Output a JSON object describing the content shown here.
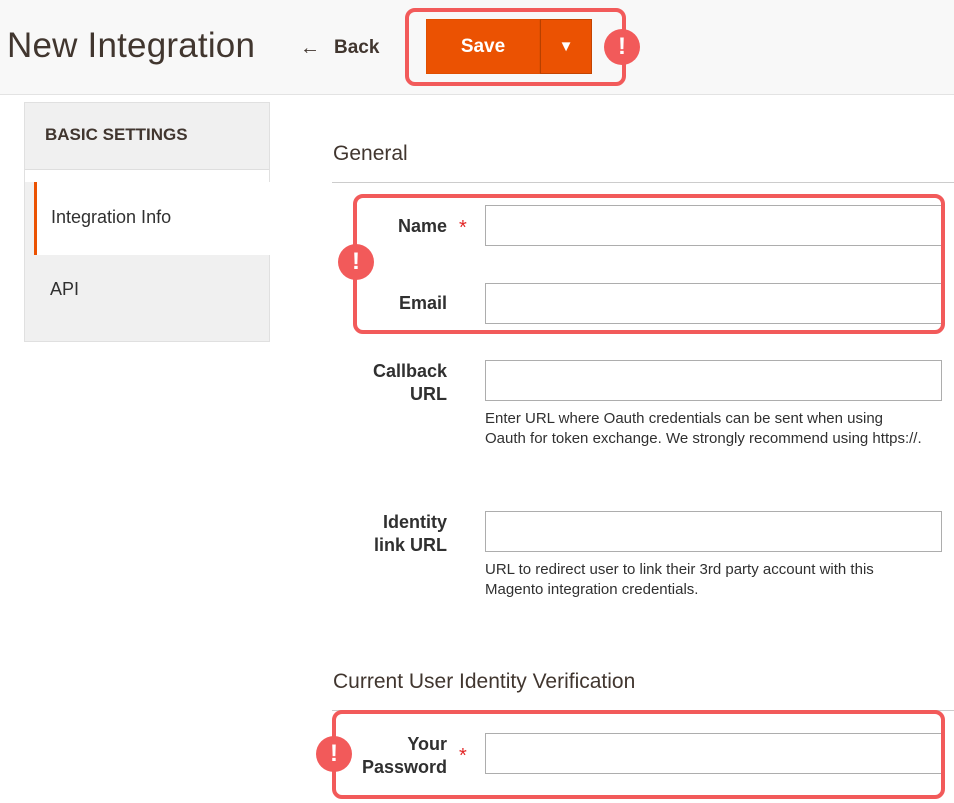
{
  "header": {
    "page_title": "New Integration",
    "back_label": "Back",
    "back_icon": "arrow-left-icon",
    "save_label": "Save",
    "dropdown_icon": "caret-down-icon"
  },
  "sidebar": {
    "heading": "BASIC SETTINGS",
    "items": [
      {
        "label": "Integration Info",
        "active": true
      },
      {
        "label": "API",
        "active": false
      }
    ]
  },
  "general": {
    "title": "General",
    "name_label": "Name",
    "name_value": "",
    "email_label": "Email",
    "email_value": "",
    "callback_label_line1": "Callback",
    "callback_label_line2": "URL",
    "callback_value": "",
    "callback_note": "Enter URL where Oauth credentials can be sent when using Oauth for token exchange. We strongly recommend using https://.",
    "identity_label_line1": "Identity",
    "identity_label_line2": "link URL",
    "identity_value": "",
    "identity_note": "URL to redirect user to link their 3rd party account with this Magento integration credentials."
  },
  "verification": {
    "title": "Current User Identity Verification",
    "password_label_line1": "Your",
    "password_label_line2": "Password",
    "password_value": ""
  },
  "markers": {
    "required_symbol": "*",
    "alert_symbol": "!"
  },
  "colors": {
    "accent": "#eb5202",
    "highlight": "#f25a5a",
    "required": "#e22626"
  }
}
